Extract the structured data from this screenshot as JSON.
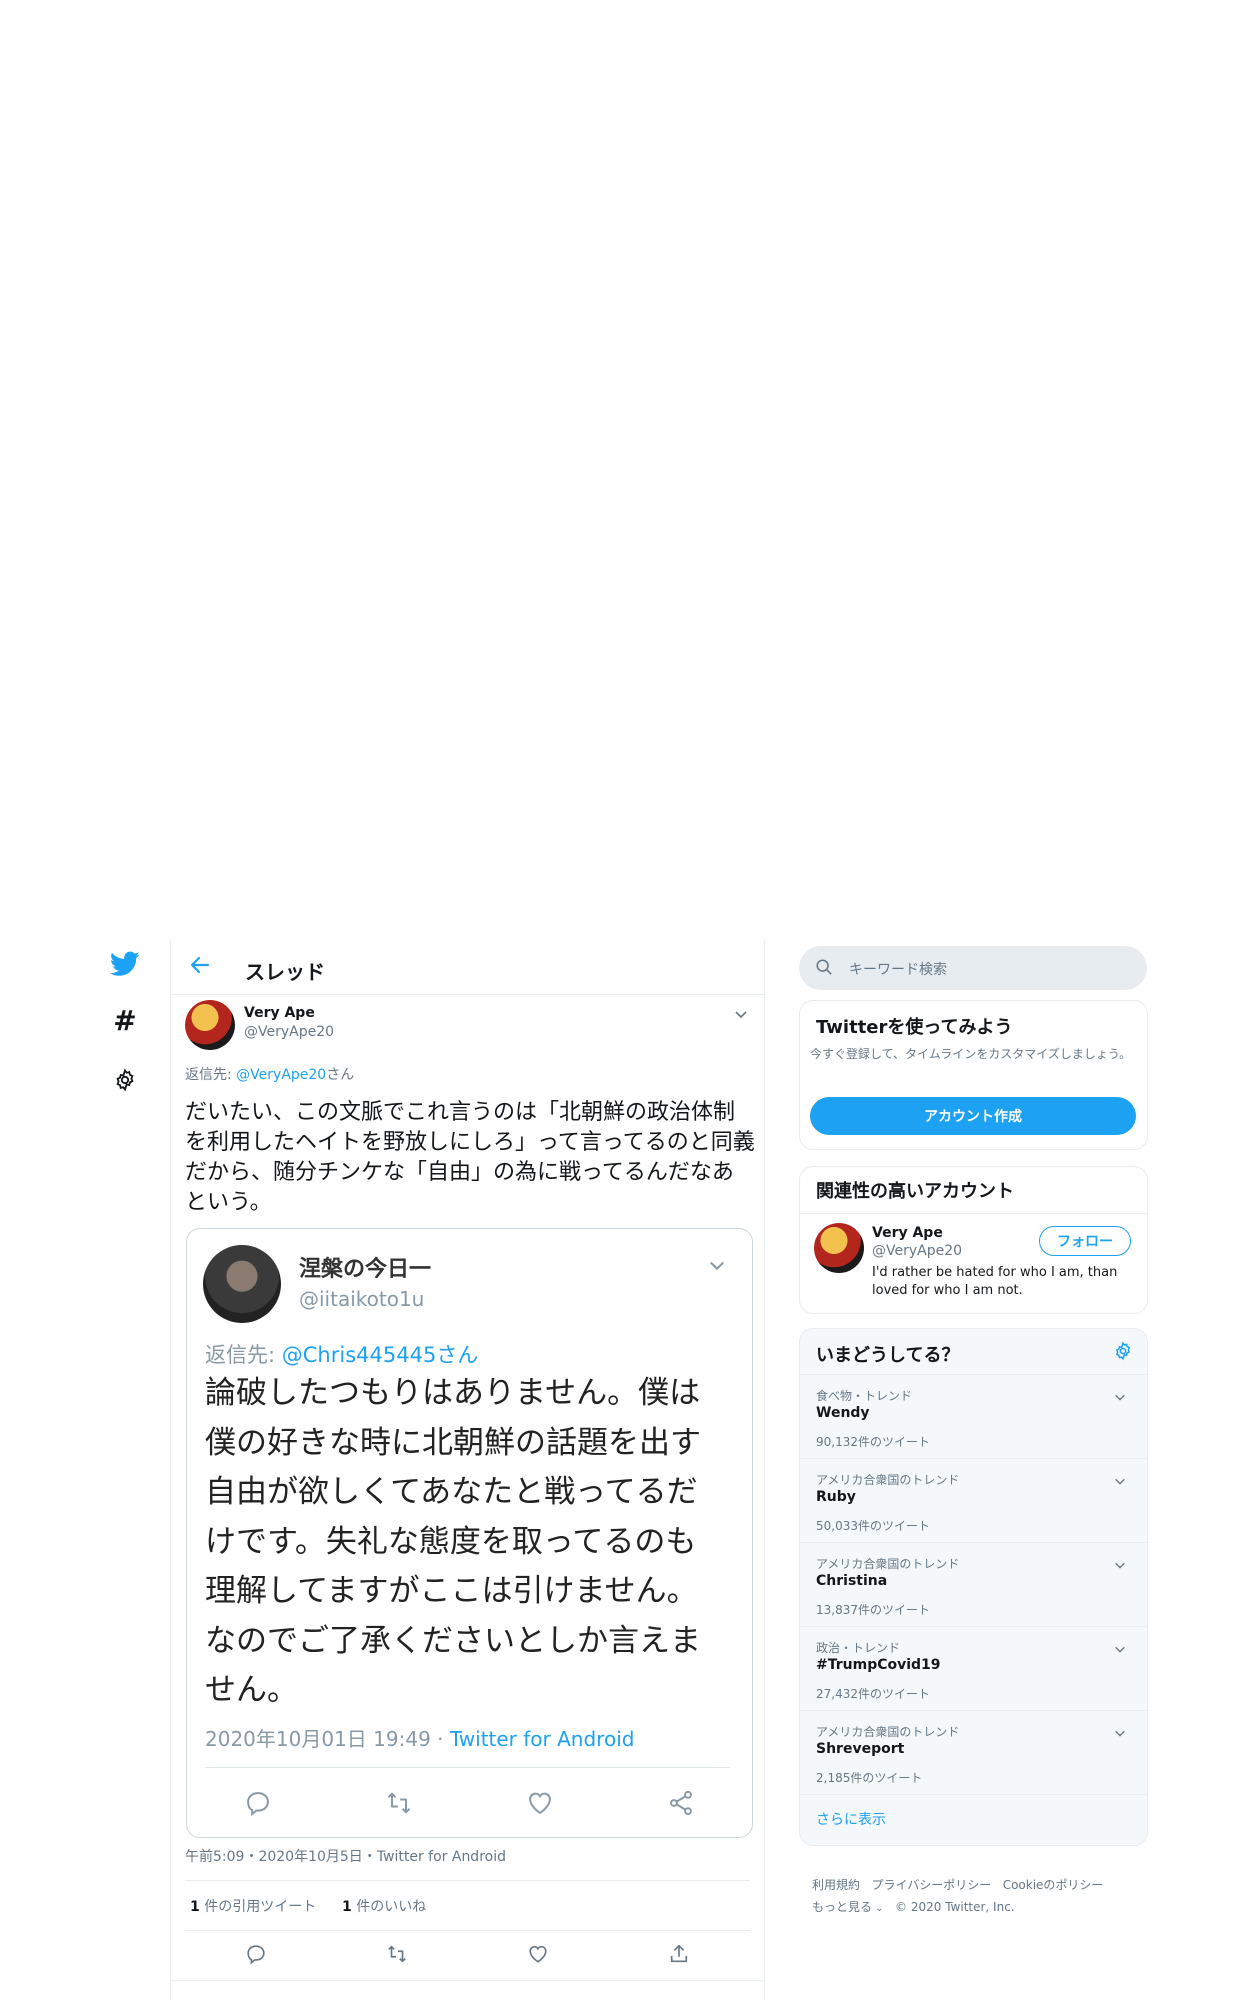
{
  "header": {
    "title": "スレッド"
  },
  "tweet": {
    "author_name": "Very Ape",
    "author_handle": "@VeryApe20",
    "reply_prefix": "返信先: ",
    "reply_to": "@VeryApe20",
    "reply_suffix": "さん",
    "text": "だいたい、この文脈でこれ言うのは「北朝鮮の政治体制を利用したヘイトを野放しにしろ」って言ってるのと同義だから、随分チンケな「自由」の為に戦ってるんだなあという。",
    "timestamp": "午前5:09・2020年10月5日・Twitter for Android",
    "quote_count": "1",
    "quote_label": "件の引用ツイート",
    "like_count": "1",
    "like_label": "件のいいね"
  },
  "quoted": {
    "author_name": "涅槃の今日一",
    "author_handle": "@iitaikoto1u",
    "reply_prefix": "返信先: ",
    "reply_to": "@Chris445445さん",
    "text": "論破したつもりはありません。僕は僕の好きな時に北朝鮮の話題を出す自由が欲しくてあなたと戦ってるだけです。失礼な態度を取ってるのも理解してますがここは引けません。なのでご了承くださいとしか言えません。",
    "date": "2020年10月01日 19:49 · ",
    "client": "Twitter for Android"
  },
  "search": {
    "placeholder": "キーワード検索"
  },
  "signup": {
    "title": "Twitterを使ってみよう",
    "desc": "今すぐ登録して、タイムラインをカスタマイズしましょう。",
    "button": "アカウント作成"
  },
  "related": {
    "title": "関連性の高いアカウント",
    "name": "Very Ape",
    "handle": "@VeryApe20",
    "follow": "フォロー",
    "bio": "I'd rather be hated for who I am, than loved for who I am not."
  },
  "trends": {
    "title": "いまどうしてる？",
    "items": [
      {
        "category": "食べ物・トレンド",
        "name": "Wendy",
        "count": "90,132件のツイート"
      },
      {
        "category": "アメリカ合衆国のトレンド",
        "name": "Ruby",
        "count": "50,033件のツイート"
      },
      {
        "category": "アメリカ合衆国のトレンド",
        "name": "Christina",
        "count": "13,837件のツイート"
      },
      {
        "category": "政治・トレンド",
        "name": "#TrumpCovid19",
        "count": "27,432件のツイート"
      },
      {
        "category": "アメリカ合衆国のトレンド",
        "name": "Shreveport",
        "count": "2,185件のツイート"
      }
    ],
    "more": "さらに表示"
  },
  "footer": {
    "terms": "利用規約",
    "privacy": "プライバシーポリシー",
    "cookie": "Cookieのポリシー",
    "more": "もっと見る",
    "copyright": "© 2020 Twitter, Inc."
  },
  "colors": {
    "accent": "#1da1f2",
    "muted": "#657786",
    "border": "#e6ecf0"
  }
}
